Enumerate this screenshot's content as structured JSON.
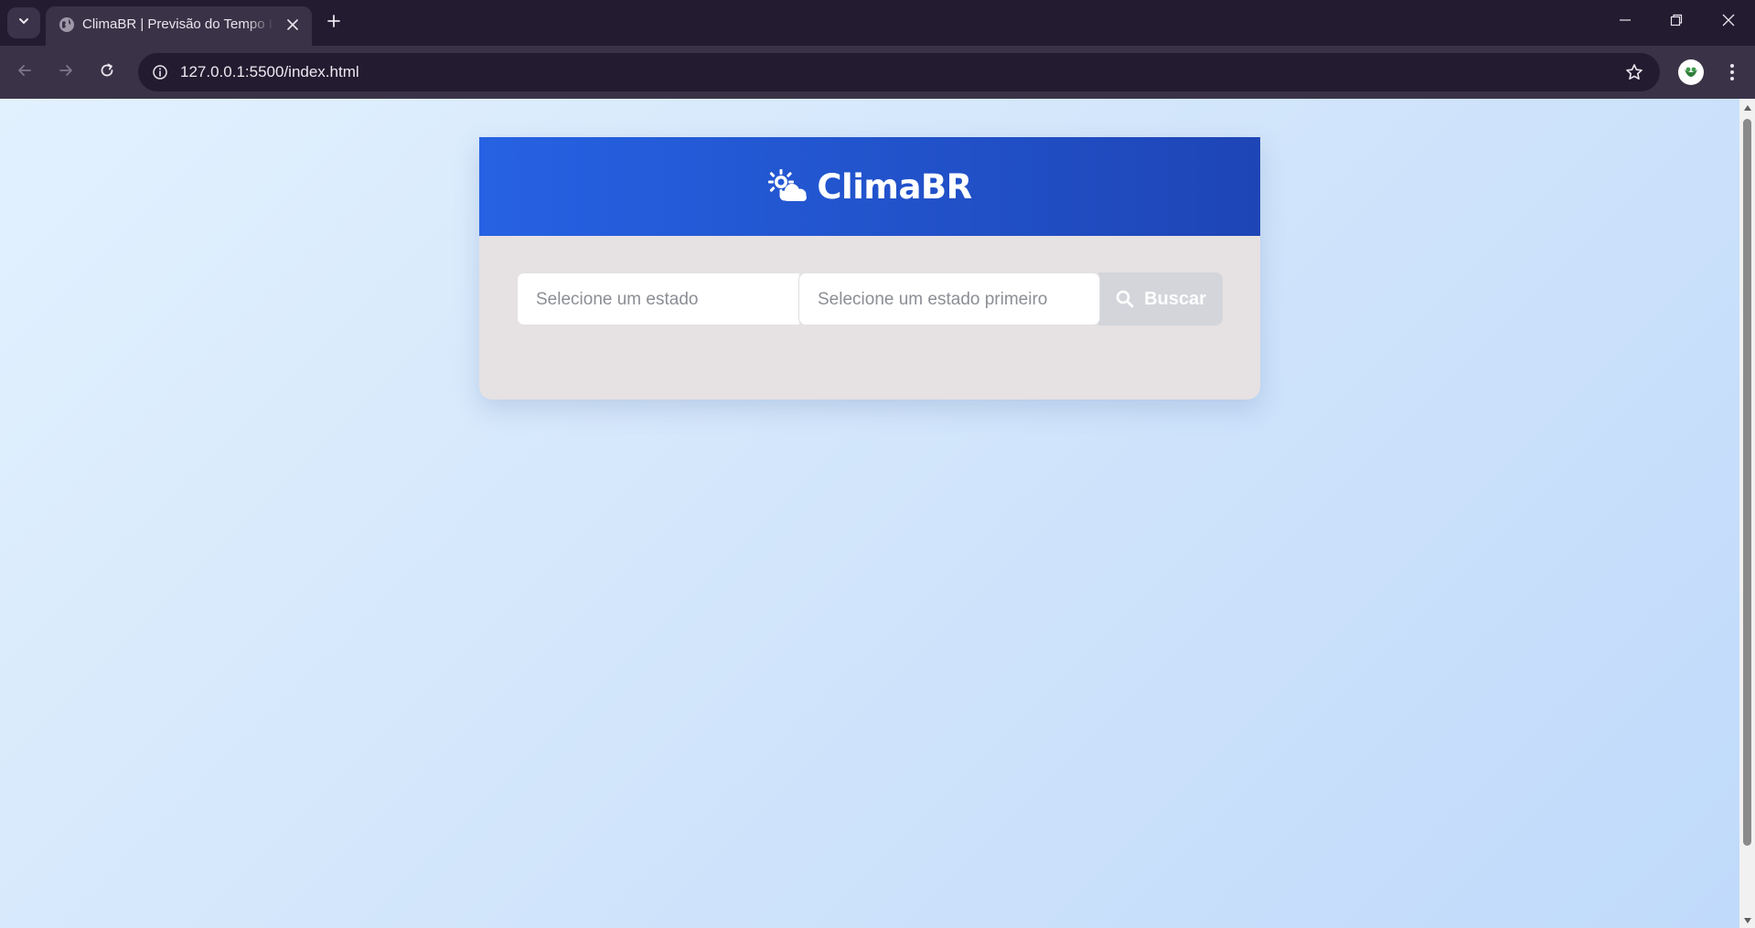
{
  "browser": {
    "tab": {
      "title": "ClimaBR | Previsão do Tempo Inteligente",
      "favicon": "globe-icon"
    },
    "url": "127.0.0.1:5500/index.html",
    "icons": {
      "tab_search": "chevron-down-icon",
      "tab_close": "close-icon",
      "new_tab": "plus-icon",
      "back": "arrow-left-icon",
      "forward": "arrow-right-icon",
      "reload": "reload-icon",
      "site_info": "info-icon",
      "bookmark": "star-icon",
      "profile": "avatar",
      "menu": "kebab-menu-icon",
      "minimize": "minimize-icon",
      "restore": "restore-icon",
      "close_window": "close-icon"
    }
  },
  "app": {
    "brand": {
      "title": "ClimaBR",
      "icon": "cloud-sun-icon"
    },
    "search": {
      "state_placeholder": "Selecione um estado",
      "city_placeholder": "Selecione um estado primeiro",
      "button_label": "Buscar",
      "button_icon": "search-icon"
    }
  },
  "colors": {
    "header_gradient_start": "#2662e3",
    "header_gradient_end": "#1e45b6",
    "card_background": "#e6e1e2",
    "button_disabled": "#d3d5db",
    "page_background": "#d3e6fb"
  }
}
